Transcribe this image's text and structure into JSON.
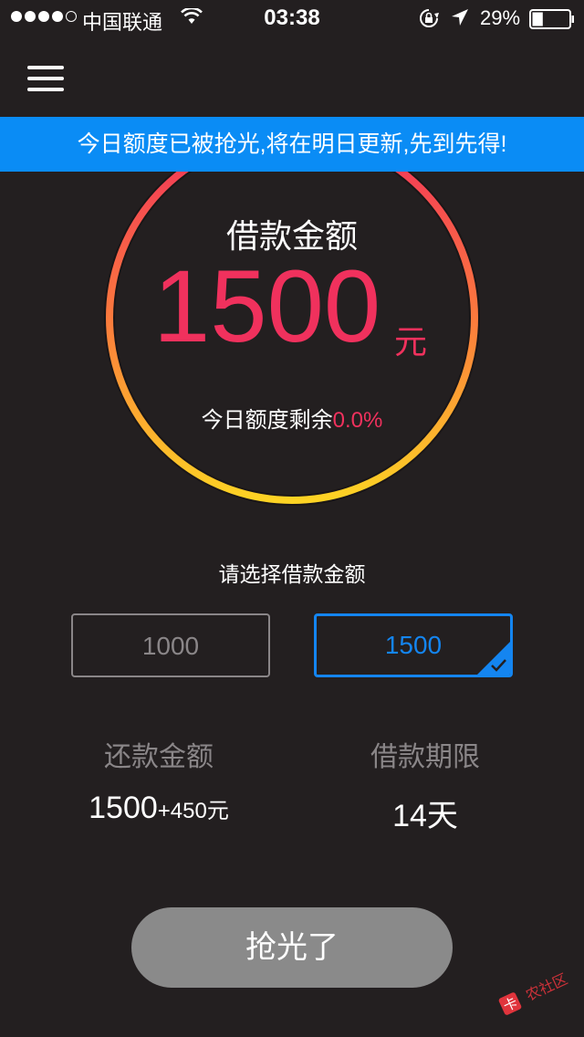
{
  "status_bar": {
    "carrier": "中国联通",
    "time": "03:38",
    "battery_percent": "29%",
    "battery_level": 0.29
  },
  "banner": {
    "text": "今日额度已被抢光,将在明日更新,先到先得!"
  },
  "gauge": {
    "title": "借款金额",
    "amount": "1500",
    "unit": "元",
    "remaining_label": "今日额度剩余",
    "remaining_value": "0.0%"
  },
  "select": {
    "label": "请选择借款金额",
    "options": [
      "1000",
      "1500"
    ],
    "selected": "1500"
  },
  "repay": {
    "label": "还款金额",
    "principal": "1500",
    "extra": "+450元"
  },
  "term": {
    "label": "借款期限",
    "value": "14天"
  },
  "action": {
    "label": "抢光了"
  },
  "watermark": {
    "text": "卡农社区"
  },
  "colors": {
    "background": "#231f20",
    "banner": "#0a8cf5",
    "accent_red": "#f0315d",
    "accent_blue": "#1485f0",
    "muted": "#8a8688",
    "button_disabled": "#8a8a8a"
  }
}
